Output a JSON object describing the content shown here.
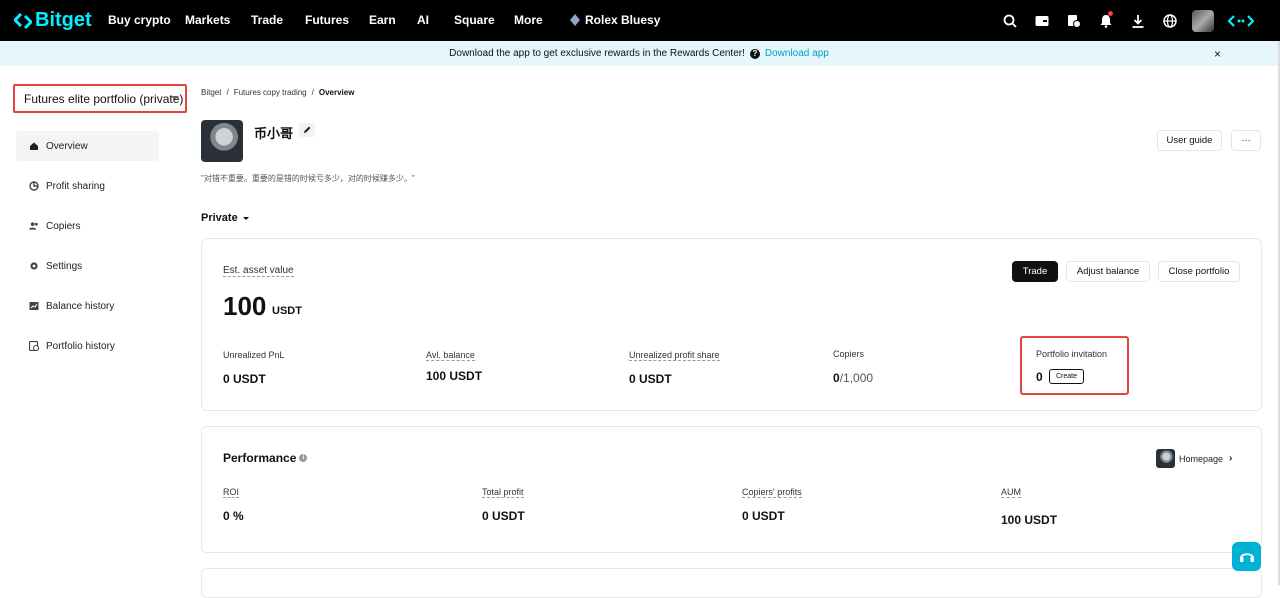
{
  "nav": {
    "logo": "Bitget",
    "items": [
      "Buy crypto",
      "Markets",
      "Trade",
      "Futures",
      "Earn",
      "AI",
      "Square",
      "More"
    ],
    "user": "Rolex Bluesy"
  },
  "banner": {
    "text": "Download the app to get exclusive rewards in the Rewards Center!",
    "link": "Download app",
    "close": "×"
  },
  "sidebar": {
    "portfolio_select": "Futures elite portfolio (private)",
    "items": [
      {
        "label": "Overview",
        "icon": "home-icon"
      },
      {
        "label": "Profit sharing",
        "icon": "pie-icon"
      },
      {
        "label": "Copiers",
        "icon": "users-icon"
      },
      {
        "label": "Settings",
        "icon": "gear-icon"
      },
      {
        "label": "Balance history",
        "icon": "chart-icon"
      },
      {
        "label": "Portfolio history",
        "icon": "clock-icon"
      }
    ]
  },
  "breadcrumb": [
    "Bitget",
    "Futures copy trading",
    "Overview"
  ],
  "profile": {
    "name": "币小哥",
    "bio": "\"对错不重要。重要的是错的时候亏多少，对的时候赚多少。\"",
    "user_guide": "User guide",
    "more": "···"
  },
  "section": {
    "label": "Private"
  },
  "asset": {
    "label": "Est. asset value",
    "value": "100",
    "unit": "USDT",
    "trade": "Trade",
    "adjust": "Adjust balance",
    "close": "Close portfolio",
    "stats": {
      "unrealized_pnl_label": "Unrealized PnL",
      "unrealized_pnl": "0 USDT",
      "avl_balance_label": "Avl. balance",
      "avl_balance": "100 USDT",
      "unrealized_share_label": "Unrealized profit share",
      "unrealized_share": "0 USDT",
      "copiers_label": "Copiers",
      "copiers_count": "0",
      "copiers_max": "/1,000",
      "invitation_label": "Portfolio invitation",
      "invitation_count": "0",
      "create": "Create"
    }
  },
  "performance": {
    "title": "Performance",
    "homepage": "Homepage",
    "roi_label": "ROI",
    "roi": "0 %",
    "total_profit_label": "Total profit",
    "total_profit": "0 USDT",
    "copiers_profits_label": "Copiers' profits",
    "copiers_profits": "0 USDT",
    "aum_label": "AUM",
    "aum": "100 USDT"
  }
}
